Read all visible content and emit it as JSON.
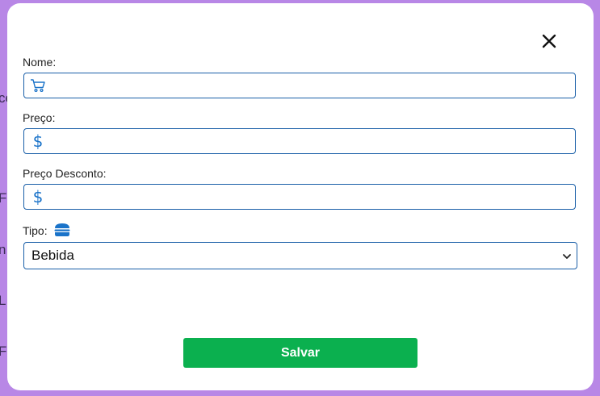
{
  "background_fragments": [
    "ce",
    "Fr",
    "n T",
    "L",
    "Fo"
  ],
  "modal": {
    "close_icon": "close-icon",
    "fields": {
      "nome": {
        "label": "Nome:",
        "icon": "cart-icon",
        "value": "",
        "placeholder": ""
      },
      "preco": {
        "label": "Preço:",
        "icon": "dollar-icon",
        "icon_glyph": "$",
        "value": "",
        "placeholder": ""
      },
      "preco_desconto": {
        "label": "Preço Desconto:",
        "icon": "dollar-icon",
        "icon_glyph": "$",
        "value": "",
        "placeholder": ""
      },
      "tipo": {
        "label": "Tipo:",
        "icon": "burger-icon",
        "selected": "Bebida"
      }
    },
    "save_label": "Salvar"
  },
  "colors": {
    "backdrop": "#b887e6",
    "border": "#1a5fa8",
    "icon": "#1a73c9",
    "save_button": "#0bb04f"
  }
}
